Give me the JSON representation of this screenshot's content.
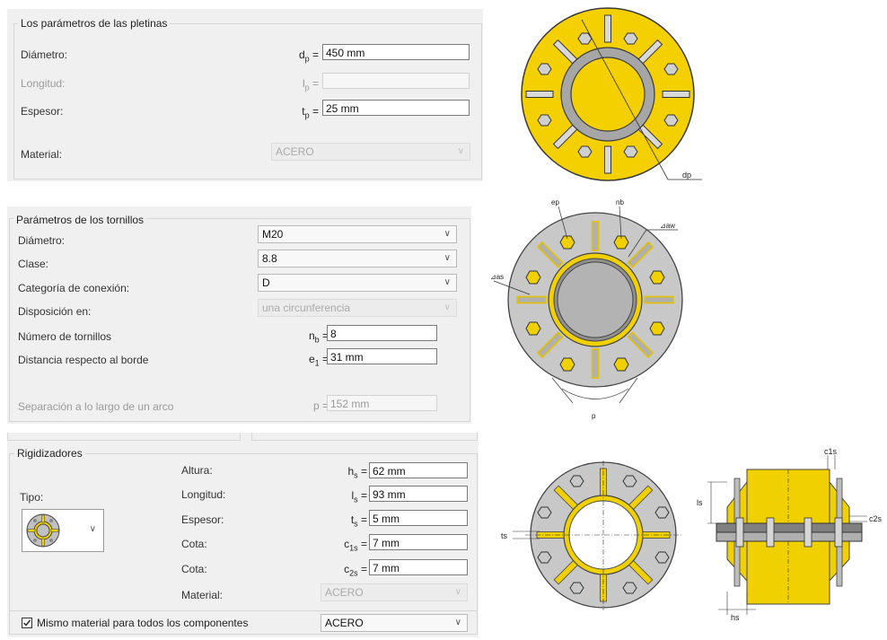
{
  "plates": {
    "title": "Los parámetros de las pletinas",
    "diameter": {
      "label": "Diámetro:",
      "sym": "d",
      "sub": "p",
      "eq": " =",
      "value": "450 mm"
    },
    "length": {
      "label": "Longitud:",
      "sym": "l",
      "sub": "p",
      "eq": " =",
      "value": ""
    },
    "thickness": {
      "label": "Espesor:",
      "sym": "t",
      "sub": "p",
      "eq": " =",
      "value": "25 mm"
    },
    "material": {
      "label": "Material:",
      "value": "ACERO"
    },
    "drawing_label": "dp"
  },
  "bolts": {
    "title": "Parámetros de los tornillos",
    "diameter": {
      "label": "Diámetro:",
      "value": "M20"
    },
    "class": {
      "label": "Clase:",
      "value": "8.8"
    },
    "category": {
      "label": "Categoría de conexión:",
      "value": "D"
    },
    "arrangement": {
      "label": "Disposición en:",
      "value": "una circunferencia"
    },
    "count": {
      "label": "Número de tornillos",
      "sym": "n",
      "sub": "b",
      "eq": " =",
      "value": "8"
    },
    "edge": {
      "label": "Distancia respecto al borde",
      "sym": "e",
      "sub": "1",
      "eq": " =",
      "value": "31 mm"
    },
    "spacing": {
      "label": "Separación a lo largo de un arco",
      "sym": "p",
      "eq": " =",
      "value": "152 mm"
    },
    "drawing_labels": {
      "ep": "ep",
      "nb": "nb",
      "aw": "⊿aw",
      "as": "⊿as",
      "p": "p"
    }
  },
  "stiffeners": {
    "title": "Rigidizadores",
    "type_label": "Tipo:",
    "height": {
      "label": "Altura:",
      "sym": "h",
      "sub": "s",
      "eq": " =",
      "value": "62 mm"
    },
    "length": {
      "label": "Longitud:",
      "sym": "l",
      "sub": "s",
      "eq": " =",
      "value": "93 mm"
    },
    "thickness": {
      "label": "Espesor:",
      "sym": "t",
      "sub": "s",
      "eq": " =",
      "value": "5 mm"
    },
    "dim1": {
      "label": "Cota:",
      "sym": "c",
      "sub": "1s",
      "eq": " =",
      "value": "7 mm"
    },
    "dim2": {
      "label": "Cota:",
      "sym": "c",
      "sub": "2s",
      "eq": " =",
      "value": "7 mm"
    },
    "material": {
      "label": "Material:",
      "value": "ACERO"
    },
    "drawing_labels": {
      "ts": "ts",
      "ls": "ls",
      "hs": "hs",
      "c1s": "c1s",
      "c2s": "c2s"
    }
  },
  "same_material": {
    "label": "Mismo material para todos los componentes",
    "checked": true,
    "value": "ACERO"
  }
}
